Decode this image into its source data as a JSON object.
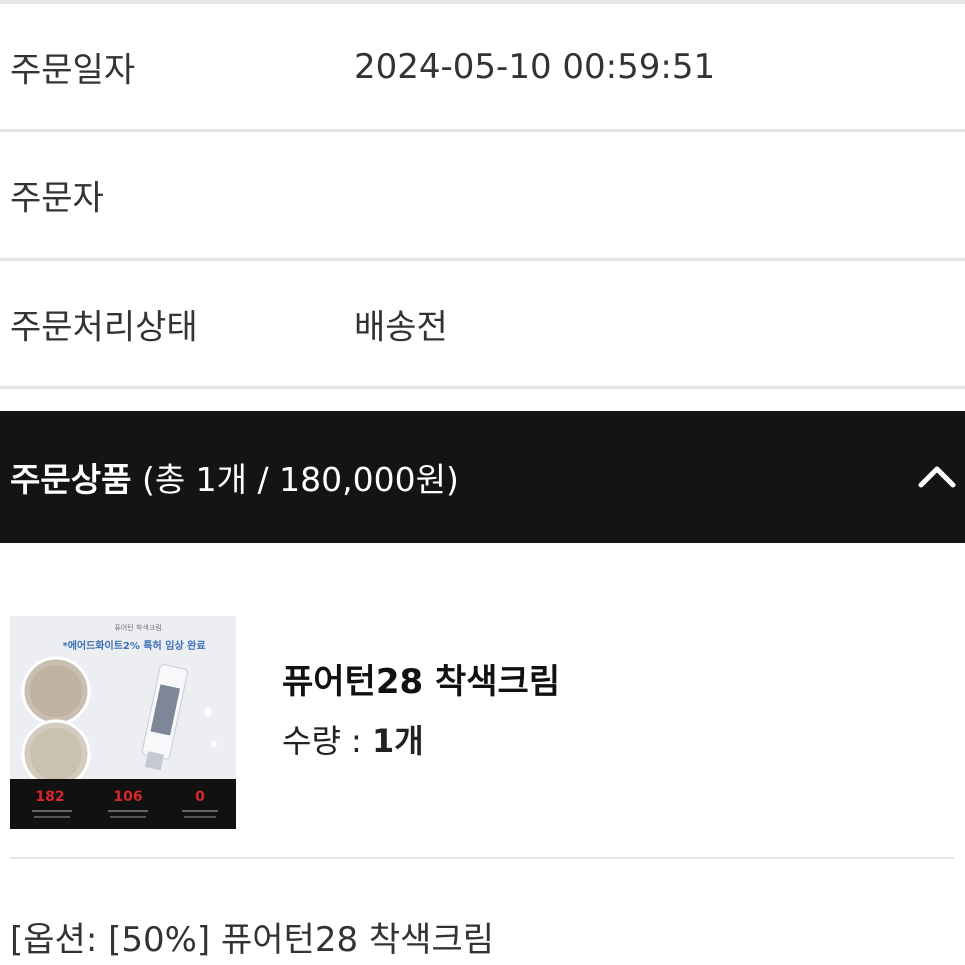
{
  "order_info": {
    "rows": [
      {
        "label": "주문일자",
        "value": "2024-05-10 00:59:51"
      },
      {
        "label": "주문자",
        "value": ""
      },
      {
        "label": "주문처리상태",
        "value": "배송전"
      }
    ]
  },
  "section": {
    "title": "주문상품",
    "summary": "(총 1개 / 180,000원)",
    "collapse_icon": "chevron-up-icon"
  },
  "product": {
    "name": "퓨어턴28 착색크림",
    "qty_label": "수량 : ",
    "qty_value": "1개",
    "thumb": {
      "caption_small": "퓨어턴 착색크림",
      "headline": "*에어드화이트2% 특허 임상 완료",
      "stat1": "182",
      "stat2": "106",
      "stat3": "0"
    }
  },
  "option": {
    "text": "[옵션: [50%] 퓨어턴28 착색크림"
  },
  "colors": {
    "header_bg": "#141414",
    "divider": "#e3e3e3",
    "accent_red": "#d8262a"
  }
}
